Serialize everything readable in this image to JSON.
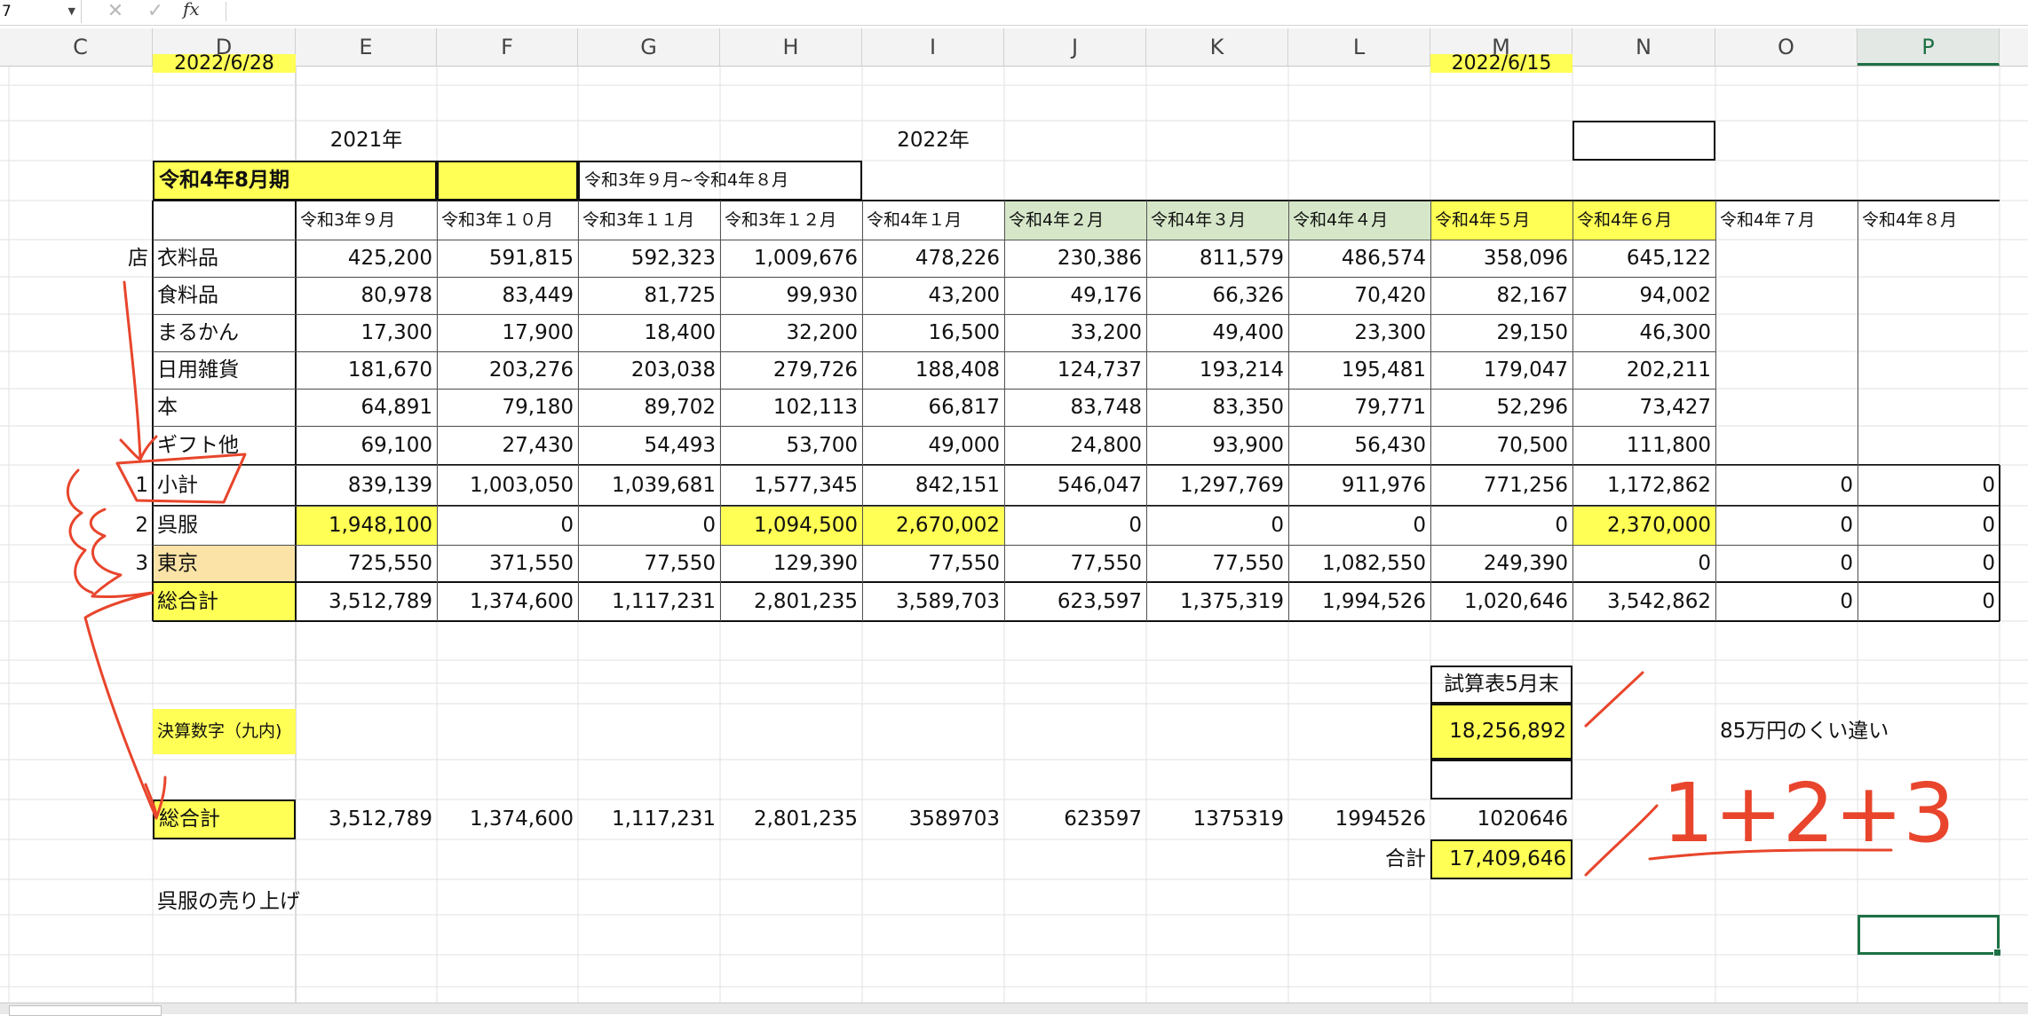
{
  "formula_bar": {
    "name_box": "7",
    "fx_label": "fx",
    "cancel_glyph": "✕",
    "confirm_glyph": "✓"
  },
  "columns": [
    "C",
    "D",
    "E",
    "F",
    "G",
    "H",
    "I",
    "J",
    "K",
    "L",
    "M",
    "N",
    "O",
    "P"
  ],
  "selected_column": "P",
  "partial_top": {
    "d": "2022/6/28",
    "m": "2022/6/15"
  },
  "years": {
    "y2021": "2021年",
    "y2022": "2022年"
  },
  "period": {
    "label": "令和4年8月期",
    "range": "令和3年９月~令和4年８月"
  },
  "months": [
    "令和3年９月",
    "令和3年１０月",
    "令和3年１１月",
    "令和3年１２月",
    "令和4年１月",
    "令和4年２月",
    "令和4年３月",
    "令和4年４月",
    "令和4年５月",
    "令和4年６月",
    "令和4年７月",
    "令和4年８月"
  ],
  "store_label": "店",
  "category_rows": [
    {
      "label": "衣料品",
      "values": [
        "425,200",
        "591,815",
        "592,323",
        "1,009,676",
        "478,226",
        "230,386",
        "811,579",
        "486,574",
        "358,096",
        "645,122",
        "",
        ""
      ]
    },
    {
      "label": "食料品",
      "values": [
        "80,978",
        "83,449",
        "81,725",
        "99,930",
        "43,200",
        "49,176",
        "66,326",
        "70,420",
        "82,167",
        "94,002",
        "",
        ""
      ]
    },
    {
      "label": "まるかん",
      "values": [
        "17,300",
        "17,900",
        "18,400",
        "32,200",
        "16,500",
        "33,200",
        "49,400",
        "23,300",
        "29,150",
        "46,300",
        "",
        ""
      ]
    },
    {
      "label": "日用雑貨",
      "values": [
        "181,670",
        "203,276",
        "203,038",
        "279,726",
        "188,408",
        "124,737",
        "193,214",
        "195,481",
        "179,047",
        "202,211",
        "",
        ""
      ]
    },
    {
      "label": "本",
      "values": [
        "64,891",
        "79,180",
        "89,702",
        "102,113",
        "66,817",
        "83,748",
        "83,350",
        "79,771",
        "52,296",
        "73,427",
        "",
        ""
      ]
    },
    {
      "label": "ギフト他",
      "values": [
        "69,100",
        "27,430",
        "54,493",
        "53,700",
        "49,000",
        "24,800",
        "93,900",
        "56,430",
        "70,500",
        "111,800",
        "",
        ""
      ]
    }
  ],
  "subtotal_rows": [
    {
      "num": "1",
      "label": "小計",
      "values": [
        "839,139",
        "1,003,050",
        "1,039,681",
        "1,577,345",
        "842,151",
        "546,047",
        "1,297,769",
        "911,976",
        "771,256",
        "1,172,862",
        "0",
        "0"
      ]
    },
    {
      "num": "2",
      "label": "呉服",
      "values": [
        "1,948,100",
        "0",
        "0",
        "1,094,500",
        "2,670,002",
        "0",
        "0",
        "0",
        "0",
        "2,370,000",
        "0",
        "0"
      ]
    },
    {
      "num": "3",
      "label": "東京",
      "values": [
        "725,550",
        "371,550",
        "77,550",
        "129,390",
        "77,550",
        "77,550",
        "77,550",
        "1,082,550",
        "249,390",
        "0",
        "0",
        "0"
      ]
    }
  ],
  "grand_total": {
    "label": "総合計",
    "values": [
      "3,512,789",
      "1,374,600",
      "1,117,231",
      "2,801,235",
      "3,589,703",
      "623,597",
      "1,375,319",
      "1,994,526",
      "1,020,646",
      "3,542,862",
      "0",
      "0"
    ]
  },
  "trial_balance": {
    "label": "試算表5月末",
    "value": "18,256,892"
  },
  "settlement_label": "決算数字（九内)",
  "diff_note": "85万円のくい違い",
  "grand_total_2": {
    "label": "総合計",
    "values": [
      "3,512,789",
      "1,374,600",
      "1,117,231",
      "2,801,235",
      "3589703",
      "623597",
      "1375319",
      "1994526",
      "1020646"
    ]
  },
  "sum": {
    "label": "合計",
    "value": "17,409,646"
  },
  "kimono_note": "呉服の売り上げ",
  "handwritten": "1+2+3",
  "colors": {
    "highlight_yellow": "#ffff55",
    "header_green": "#d6e7c9",
    "tan": "#fbe3a7",
    "ink_red": "#e8452c",
    "excel_green": "#1e7145"
  }
}
